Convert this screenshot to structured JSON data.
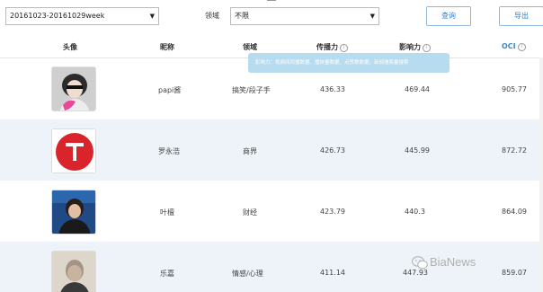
{
  "toolbar": {
    "date_range_value": "20161023-20161029week",
    "field_label": "领域",
    "field_select_value": "不限",
    "query_button": "查询",
    "export_button": "导出"
  },
  "table": {
    "headers": {
      "avatar": "头像",
      "nickname": "昵称",
      "field": "领域",
      "spread": "传播力",
      "influence": "影响力",
      "oci": "OCI"
    },
    "tooltip": "影响力：视频网同播数据、播放量数据、点赞数数据，新闻搜索量搜索",
    "rows": [
      {
        "nickname": "papi酱",
        "field": "搞笑/段子手",
        "spread": "436.33",
        "influence": "469.44",
        "oci": "905.77"
      },
      {
        "nickname": "罗永浩",
        "field": "商界",
        "spread": "426.73",
        "influence": "445.99",
        "oci": "872.72"
      },
      {
        "nickname": "叶檀",
        "field": "财经",
        "spread": "423.79",
        "influence": "440.3",
        "oci": "864.09"
      },
      {
        "nickname": "乐嘉",
        "field": "情感/心理",
        "spread": "411.14",
        "influence": "447.93",
        "oci": "859.07"
      }
    ]
  },
  "watermark": {
    "text": "BiaNews"
  },
  "colors": {
    "accent": "#3b86c9",
    "row_alt": "#eef3f9",
    "tooltip_bg": "#b7dbef",
    "logo_red": "#d9242b"
  }
}
